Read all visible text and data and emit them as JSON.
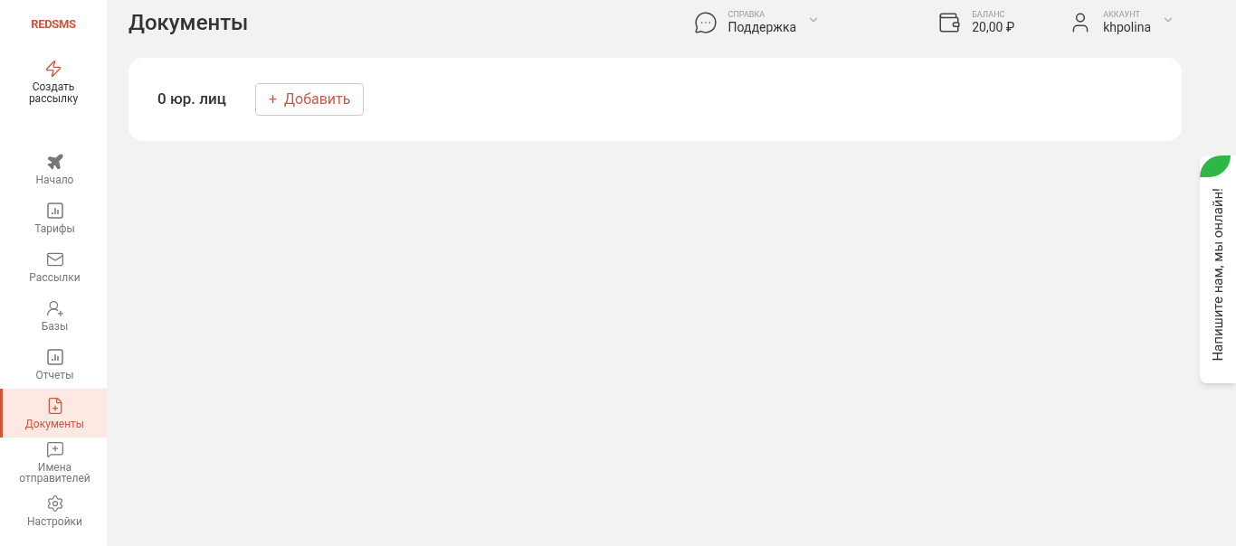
{
  "logo": "REDSMS",
  "create_button": {
    "label": "Создать рассылку"
  },
  "sidebar": {
    "items": [
      {
        "label": "Начало",
        "selected": false
      },
      {
        "label": "Тарифы",
        "selected": false
      },
      {
        "label": "Рассылки",
        "selected": false
      },
      {
        "label": "Базы",
        "selected": false
      },
      {
        "label": "Отчеты",
        "selected": false
      },
      {
        "label": "Документы",
        "selected": true
      },
      {
        "label": "Имена отправителей",
        "selected": false
      },
      {
        "label": "Настройки",
        "selected": false
      }
    ]
  },
  "page_title": "Документы",
  "header": {
    "help": {
      "caption": "СПРАВКА",
      "value": "Поддержка"
    },
    "balance": {
      "caption": "БАЛАНС",
      "value": "20,00 ₽"
    },
    "account": {
      "caption": "АККАУНТ",
      "value": "khpolina"
    }
  },
  "card": {
    "count": "0 юр. лиц",
    "add_button": {
      "icon": "+",
      "label": "Добавить"
    }
  },
  "chat_widget": {
    "label": "Напишите нам, мы онлайн!"
  }
}
